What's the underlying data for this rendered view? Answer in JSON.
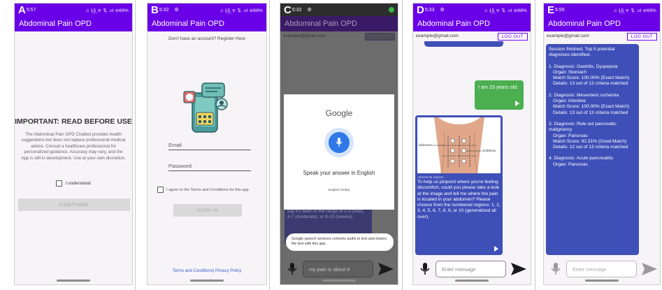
{
  "panels": {
    "a": {
      "letter": "A",
      "time": "5:57",
      "status_icons": "♫ 1̲5̲ ᯤ ⇅ .ııl ⊘69%",
      "app_title": "Abdominal Pain OPD",
      "heading": "IMPORTANT: READ BEFORE USE",
      "body": "The Abdominal Pain OPD Chatbot provides health suggestions but does not replace professional medical advice. Consult a healthcare professional for personalized guidance. Accuracy may vary, and the App is still in development. Use at your own discretion.",
      "checkbox_label": "I understand",
      "button_label": "CONTINUE"
    },
    "b": {
      "letter": "B",
      "time": "5:32",
      "status_icons": "♫ 1̲5̲ ᯤ ⇅ .ııl ⊘68%",
      "app_title": "Abdominal Pain OPD",
      "register_text": "Don't have an account? Register Here",
      "email_placeholder": "Email",
      "password_placeholder": "Password",
      "terms_text": "I agree to the Terms and Conditions for this app",
      "button_label": "SIGN IN",
      "footer_links": "Terms and Conditions| Privacy Policy",
      "logo_icon": "chat-phone-app-logo-icon"
    },
    "c": {
      "letter": "C",
      "time": "5:32",
      "app_title": "Abdominal Pain OPD",
      "email": "example@gmail.com",
      "logout_label": "LOG OUT",
      "google_title": "Google",
      "speak_prompt": "Speak your answer in English",
      "language": "English (India)",
      "background_message": "say it's been in the range of 1-3 (mild), 4-7 (moderate), or 8-10 (severe).",
      "toast": "Google speech services converts audio to text and shares the text with this app.",
      "input_value": "my pain is about 6"
    },
    "d": {
      "letter": "D",
      "time": "5:33",
      "status_icons": "♫ 1̲5̲ ᯤ ⇅ .ııl ⊘68%",
      "app_title": "Abdominal Pain OPD",
      "email": "example@gmail.com",
      "logout_label": "LOG OUT",
      "user_message": "I am 23 years old",
      "image_caption": "Abdominal regions",
      "label_abdomen": "Abdomen",
      "label_umbilicus": "Umbilicus",
      "bot_message": "To help us pinpoint where you're feeling discomfort, could you please take a look at the image and tell me where the pain is located in your abdomen? Please choose from the numbered regions: 1, 2, 3, 4, 5, 6, 7, 8, 9, or 10 (generalized all over).",
      "input_placeholder": "Enter message"
    },
    "e": {
      "letter": "E",
      "time": "5:55",
      "status_icons": "♫ 1̲5̲ ᯤ ⇅ .ııl ⊘69%",
      "app_title": "Abdominal Pain OPD",
      "email": "example@gmail.com",
      "logout_label": "LOG OUT",
      "intro": "Session finished. Top 5 potential diagnoses identified.",
      "diagnoses": [
        {
          "title": "1. Diagnosis: Gastritis, Dyspepsia",
          "organ": "Organ: Stomach",
          "score": "Match Score: 100.00% (Exact Match)",
          "details": "Details: 13 out of 13 criteria matched"
        },
        {
          "title": "2. Diagnosis: Mesenteric ischemia",
          "organ": "Organ: Intestine",
          "score": "Match Score: 100.00% (Exact Match)",
          "details": "Details: 13 out of 13 criteria matched"
        },
        {
          "title": "3. Diagnosis: Rule out pancreatic malignancy",
          "organ": "Organ: Pancreas",
          "score": "Match Score: 92.31% (Good Match)",
          "details": "Details: 12 out of 13 criteria matched"
        },
        {
          "title": "4. Diagnosis: Acute pancreatitis",
          "organ": "Organ: Pancreas",
          "score": "",
          "details": ""
        }
      ],
      "input_placeholder": "Enter message"
    }
  },
  "colors": {
    "primary": "#6a00e8",
    "bot_bubble": "#3f4fb8",
    "user_bubble": "#4caf50",
    "google_mic": "#2f78e6"
  },
  "icons": {
    "mic": "microphone-icon",
    "send": "send-arrow-icon",
    "play": "play-icon"
  }
}
